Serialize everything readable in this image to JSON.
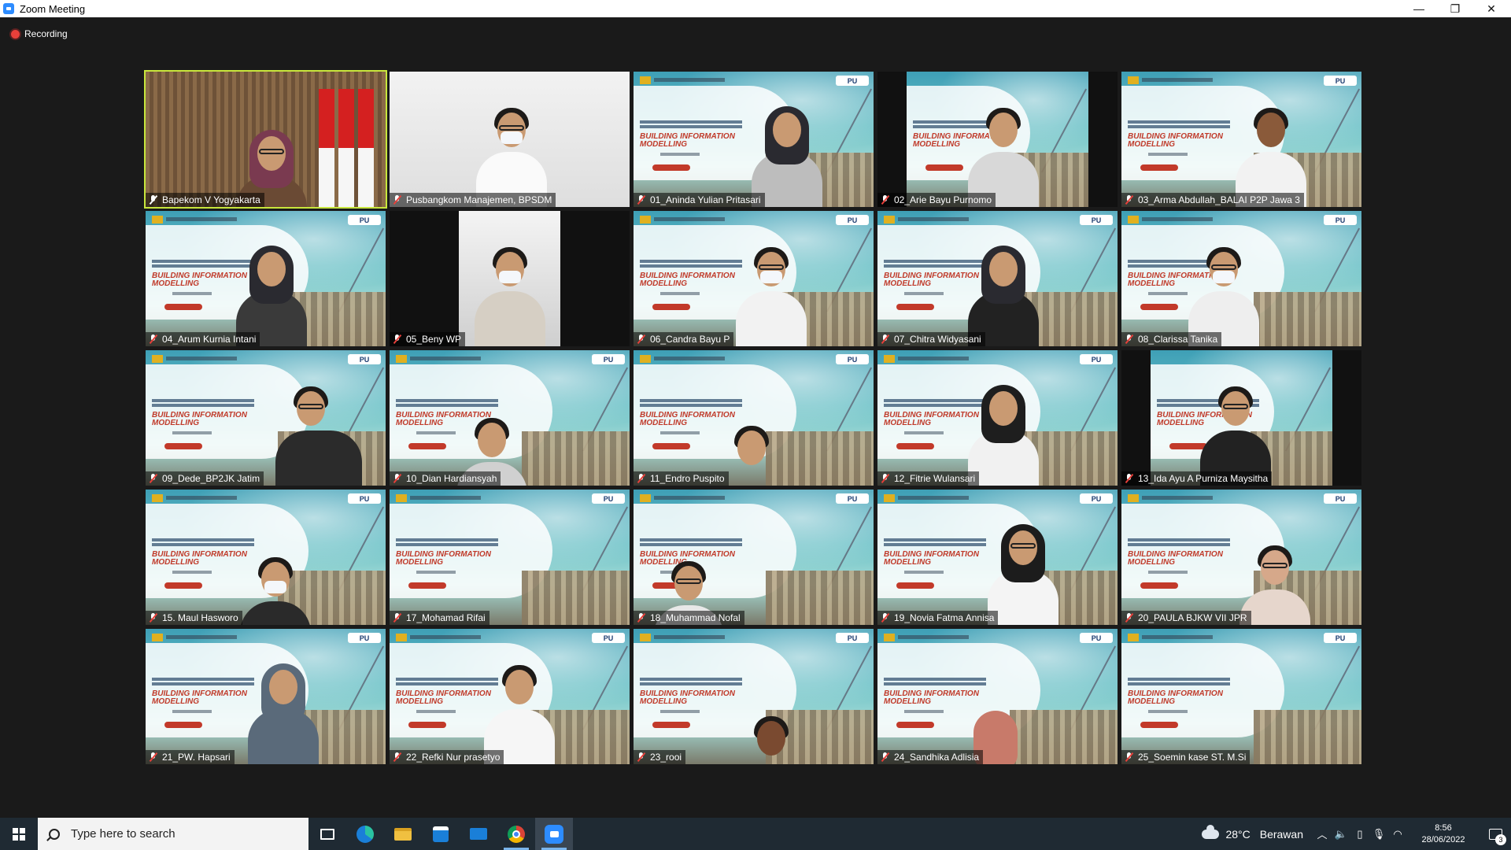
{
  "window": {
    "title": "Zoom Meeting",
    "minimize": "—",
    "restore": "❐",
    "close": "✕"
  },
  "meeting": {
    "recording_label": "Recording",
    "participants": [
      {
        "name": "Bapekom V Yogyakarta",
        "host": true
      },
      {
        "name": "Pusbangkom Manajemen, BPSDM"
      },
      {
        "name": "01_Aninda Yulian Pritasari"
      },
      {
        "name": "02_Arie Bayu Purnomo"
      },
      {
        "name": "03_Arma Abdullah_BALAI P2P Jawa 3"
      },
      {
        "name": "04_Arum Kurnia Intani"
      },
      {
        "name": "05_Beny WP"
      },
      {
        "name": "06_Candra Bayu P"
      },
      {
        "name": "07_Chitra Widyasani"
      },
      {
        "name": "08_Clarissa Tanika"
      },
      {
        "name": "09_Dede_BP2JK Jatim"
      },
      {
        "name": "10_Dian Hardiansyah"
      },
      {
        "name": "11_Endro Puspito"
      },
      {
        "name": "12_Fitrie Wulansari"
      },
      {
        "name": "13_Ida Ayu A Purniza Maysitha"
      },
      {
        "name": "15. Maul Hasworo"
      },
      {
        "name": "17_Mohamad Rifai"
      },
      {
        "name": "18_Muhammad Nofal"
      },
      {
        "name": "19_Novia Fatma Annisa"
      },
      {
        "name": "20_PAULA BJKW VII JPR"
      },
      {
        "name": "21_PW. Hapsari"
      },
      {
        "name": "22_Refki Nur prasetyo"
      },
      {
        "name": "23_rooi"
      },
      {
        "name": "24_Sandhika Adlisia"
      },
      {
        "name": "25_Soemin kase ST. M.Si"
      }
    ],
    "background": {
      "brand": "PU",
      "title_line1": "BUILDING INFORMATION",
      "title_line2": "MODELLING"
    }
  },
  "taskbar": {
    "search_placeholder": "Type here to search",
    "apps": [
      "task-view",
      "edge",
      "file-explorer",
      "microsoft-store",
      "mail",
      "chrome",
      "zoom"
    ],
    "weather": {
      "temp": "28°C",
      "desc": "Berawan"
    },
    "time": "8:56",
    "date": "28/06/2022",
    "notification_count": "3"
  },
  "colors": {
    "active_speaker_border": "#c8e63c",
    "muted_icon": "#e8403a",
    "zoom_blue": "#2d8cff"
  }
}
